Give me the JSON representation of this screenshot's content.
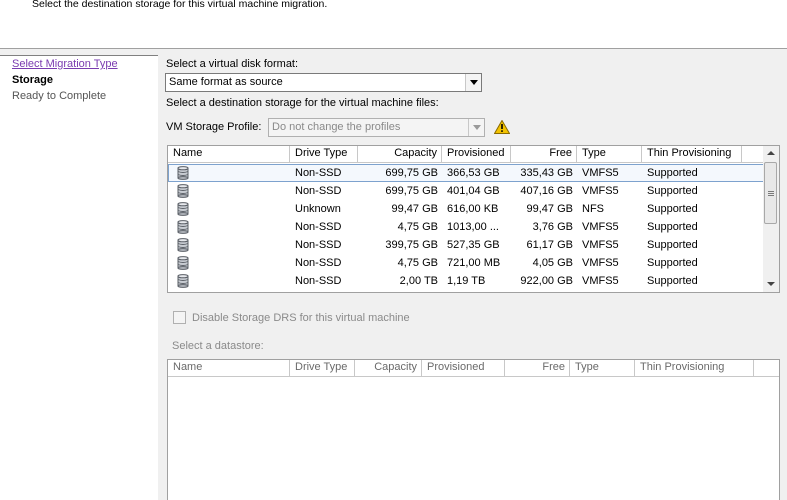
{
  "header": {
    "subtitle": "Select the destination storage for this virtual machine migration."
  },
  "sidebar": {
    "items": [
      {
        "label": "Select Migration Type",
        "state": "link"
      },
      {
        "label": "Storage",
        "state": "current"
      },
      {
        "label": "Ready to Complete",
        "state": "pending"
      }
    ]
  },
  "disk_format": {
    "label": "Select a virtual disk format:",
    "value": "Same format as source"
  },
  "destination": {
    "label": "Select a destination storage for the virtual machine files:"
  },
  "storage_profile": {
    "label": "VM Storage Profile:",
    "value": "Do not change the profiles",
    "warning_icon": "warning-triangle-icon"
  },
  "datastores": {
    "columns": [
      "Name",
      "Drive Type",
      "Capacity",
      "Provisioned",
      "Free",
      "Type",
      "Thin Provisioning"
    ],
    "rows": [
      {
        "name": "",
        "drive_type": "Non-SSD",
        "capacity": "699,75 GB",
        "provisioned": "366,53 GB",
        "free": "335,43 GB",
        "type": "VMFS5",
        "thin": "Supported"
      },
      {
        "name": "",
        "drive_type": "Non-SSD",
        "capacity": "699,75 GB",
        "provisioned": "401,04 GB",
        "free": "407,16 GB",
        "type": "VMFS5",
        "thin": "Supported"
      },
      {
        "name": "",
        "drive_type": "Unknown",
        "capacity": "99,47 GB",
        "provisioned": "616,00 KB",
        "free": "99,47 GB",
        "type": "NFS",
        "thin": "Supported"
      },
      {
        "name": "",
        "drive_type": "Non-SSD",
        "capacity": "4,75 GB",
        "provisioned": "1013,00 ...",
        "free": "3,76 GB",
        "type": "VMFS5",
        "thin": "Supported"
      },
      {
        "name": "",
        "drive_type": "Non-SSD",
        "capacity": "399,75 GB",
        "provisioned": "527,35 GB",
        "free": "61,17 GB",
        "type": "VMFS5",
        "thin": "Supported"
      },
      {
        "name": "",
        "drive_type": "Non-SSD",
        "capacity": "4,75 GB",
        "provisioned": "721,00 MB",
        "free": "4,05 GB",
        "type": "VMFS5",
        "thin": "Supported"
      },
      {
        "name": "",
        "drive_type": "Non-SSD",
        "capacity": "2,00 TB",
        "provisioned": "1,19 TB",
        "free": "922,00 GB",
        "type": "VMFS5",
        "thin": "Supported"
      }
    ],
    "selected_index": 0
  },
  "storage_drs": {
    "label": "Disable Storage DRS for this virtual machine",
    "checked": false,
    "enabled": false
  },
  "select_datastore": {
    "label": "Select a datastore:",
    "columns": [
      "Name",
      "Drive Type",
      "Capacity",
      "Provisioned",
      "Free",
      "Type",
      "Thin Provisioning"
    ]
  },
  "colors": {
    "link": "#7a3bb0",
    "selection_border": "#7da2ce",
    "warning": "#f2c200"
  }
}
